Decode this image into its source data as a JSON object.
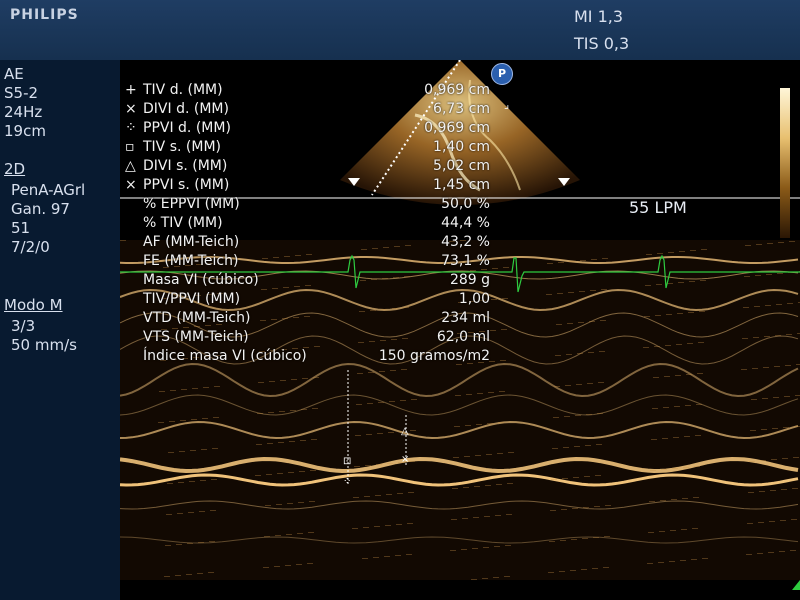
{
  "header": {
    "brand": "PHILIPS",
    "mi": "MI 1,3",
    "tis": "TIS 0,3"
  },
  "left_panel": {
    "mode": "AE",
    "probe": "S5-2",
    "frame_rate": "24Hz",
    "depth": "19cm",
    "section_2d": "2D",
    "preset": "PenA-AGrl",
    "gain": "Gan. 97",
    "dynamic": "51",
    "settings": "7/2/0",
    "section_m": "Modo M",
    "m_setting": "3/3",
    "sweep_speed": "50 mm/s"
  },
  "probe_marker": "P",
  "heart_rate": "55 LPM",
  "colors": {
    "header_bg": "#1f3d63",
    "panel_bg": "#081a30",
    "ecg": "#2ecc40",
    "echo": "#e0b070"
  },
  "measurements": [
    {
      "symbol": "+",
      "label": "TIV d. (MM)",
      "value": "0,969 cm"
    },
    {
      "symbol": "×",
      "label": "DIVI d. (MM)",
      "value": "6,73 cm"
    },
    {
      "symbol": "⁘",
      "label": "PPVI d. (MM)",
      "value": "0,969 cm"
    },
    {
      "symbol": "▫",
      "label": "TIV s. (MM)",
      "value": "1,40 cm"
    },
    {
      "symbol": "△",
      "label": "DIVI s. (MM)",
      "value": "5,02 cm"
    },
    {
      "symbol": "×",
      "label": "PPVI s. (MM)",
      "value": "1,45 cm"
    },
    {
      "symbol": "",
      "label": "% EPPVI (MM)",
      "value": "50,0 %"
    },
    {
      "symbol": "",
      "label": "% TIV (MM)",
      "value": "44,4 %"
    },
    {
      "symbol": "",
      "label": "AF (MM-Teich)",
      "value": "43,2 %"
    },
    {
      "symbol": "",
      "label": "FE (MM-Teich)",
      "value": "73,1 %"
    },
    {
      "symbol": "",
      "label": "Masa VI (cúbico)",
      "value": "289 g"
    },
    {
      "symbol": "",
      "label": "TIV/PPVI (MM)",
      "value": "1,00"
    },
    {
      "symbol": "",
      "label": "VTD (MM-Teich)",
      "value": "234 ml"
    },
    {
      "symbol": "",
      "label": "VTS (MM-Teich)",
      "value": "62,0 ml"
    },
    {
      "symbol": "",
      "label": "Índice masa VI (cúbico)",
      "value": "150 gramos/m2"
    }
  ]
}
